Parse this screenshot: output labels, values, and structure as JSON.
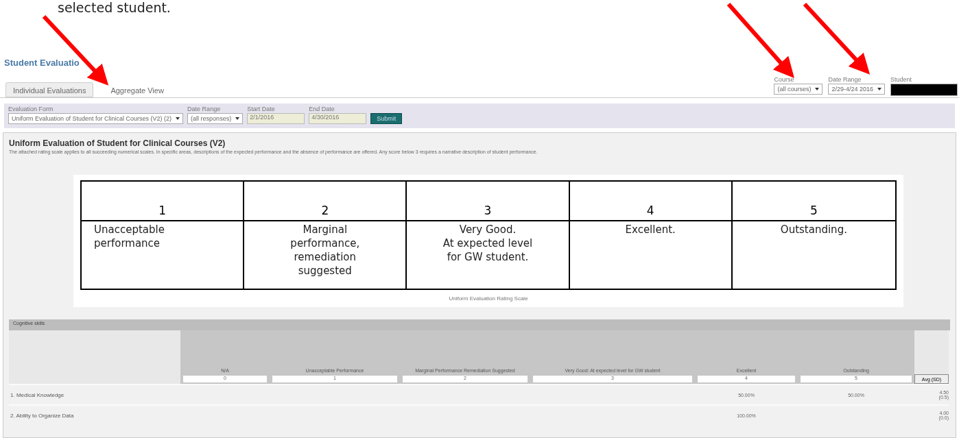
{
  "caption_text": "selected student.",
  "page_title": "Student Evaluatio",
  "tabs": [
    {
      "label": "Individual Evaluations",
      "selected": false
    },
    {
      "label": "Aggregate View",
      "selected": true
    }
  ],
  "top_filters": [
    {
      "label": "Course",
      "value": "(all courses)",
      "kind": "select"
    },
    {
      "label": "Date Range",
      "value": "2/29-4/24 2016",
      "kind": "select"
    },
    {
      "label": "Student",
      "kind": "redacted"
    }
  ],
  "form_filters": [
    {
      "label": "Evaluation Form",
      "value": "Uniform Evaluation of Student for Clinical Courses (V2) (2)",
      "kind": "select"
    },
    {
      "label": "Date Range",
      "value": "(all responses)",
      "kind": "select"
    },
    {
      "label": "Start Date",
      "value": "2/1/2016",
      "kind": "date"
    },
    {
      "label": "End Date",
      "value": "4/30/2016",
      "kind": "date"
    }
  ],
  "submit_button": "Submit",
  "form_title": "Uniform Evaluation of Student for Clinical Courses (V2)",
  "form_description": "The attached rating scale applies to all succeeding numerical scales. In specific areas, descriptions of the expected performance and the absence of performance are offered. Any score below 3 requires a narrative description of student performance.",
  "rating_scale": [
    {
      "score": "1",
      "lines": [
        "Unacceptable",
        "performance"
      ]
    },
    {
      "score": "2",
      "lines": [
        "Marginal",
        "performance,",
        "remediation",
        "suggested"
      ]
    },
    {
      "score": "3",
      "lines": [
        "Very Good.",
        "At expected level",
        "for GW student."
      ]
    },
    {
      "score": "4",
      "lines": [
        "Excellent."
      ]
    },
    {
      "score": "5",
      "lines": [
        "Outstanding."
      ]
    }
  ],
  "rating_caption": "Uniform Evaluation Rating Scale",
  "section": {
    "title": "Cognitive skills",
    "columns": [
      {
        "label": "N/A",
        "filter": "0"
      },
      {
        "label": "Unacceptable Performance",
        "filter": "1"
      },
      {
        "label": "Marginal Performance Remediation Suggested",
        "filter": "2"
      },
      {
        "label": "Very Good: At expected level for GW student",
        "filter": "3"
      },
      {
        "label": "Excellent",
        "filter": "4"
      },
      {
        "label": "Outstanding",
        "filter": "5"
      }
    ],
    "avg_button": "Avg (SD)",
    "rows": [
      {
        "label": "1. Medical Knowledge",
        "cells": [
          "",
          "",
          "",
          "",
          "50.00%",
          "50.00%"
        ],
        "avg": "4.50",
        "sd": "(0.5)"
      },
      {
        "label": "2. Ability to Organize Data",
        "cells": [
          "",
          "",
          "",
          "",
          "100.00%",
          ""
        ],
        "avg": "4.00",
        "sd": "(0.0)"
      }
    ]
  }
}
